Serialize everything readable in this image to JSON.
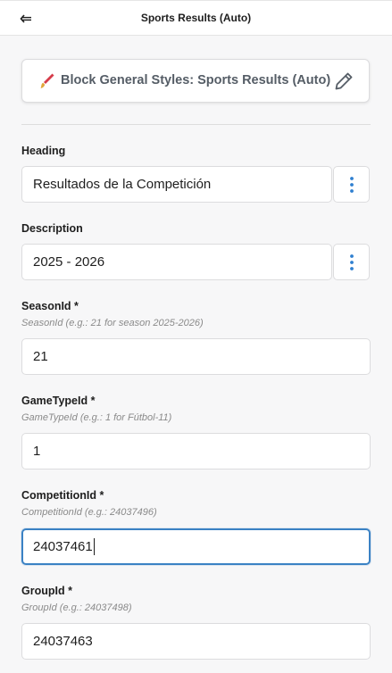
{
  "topbar": {
    "title": "Sports Results (Auto)",
    "back_icon": "arrow-left-icon"
  },
  "block_card": {
    "title": "Block General Styles: Sports Results (Auto)",
    "brush_icon": "paintbrush-icon",
    "edit_icon": "pencil-icon"
  },
  "fields": {
    "heading": {
      "label": "Heading",
      "value": "Resultados de la Competición",
      "menu_icon": "kebab-vertical-icon"
    },
    "description": {
      "label": "Description",
      "value": "2025 - 2026",
      "menu_icon": "kebab-vertical-icon"
    },
    "season_id": {
      "label": "SeasonId *",
      "help": "SeasonId (e.g.: 21 for season 2025-2026)",
      "value": "21"
    },
    "game_type_id": {
      "label": "GameTypeId *",
      "help": "GameTypeId (e.g.: 1 for Fútbol-11)",
      "value": "1"
    },
    "competition_id": {
      "label": "CompetitionId *",
      "help": "CompetitionId (e.g.: 24037496)",
      "value": "24037461"
    },
    "group_id": {
      "label": "GroupId *",
      "help": "GroupId (e.g.: 24037498)",
      "value": "24037463"
    }
  },
  "colors": {
    "accent": "#3b82c4",
    "kebab": "#2e7fd0",
    "brush_red": "#d63c4a"
  }
}
